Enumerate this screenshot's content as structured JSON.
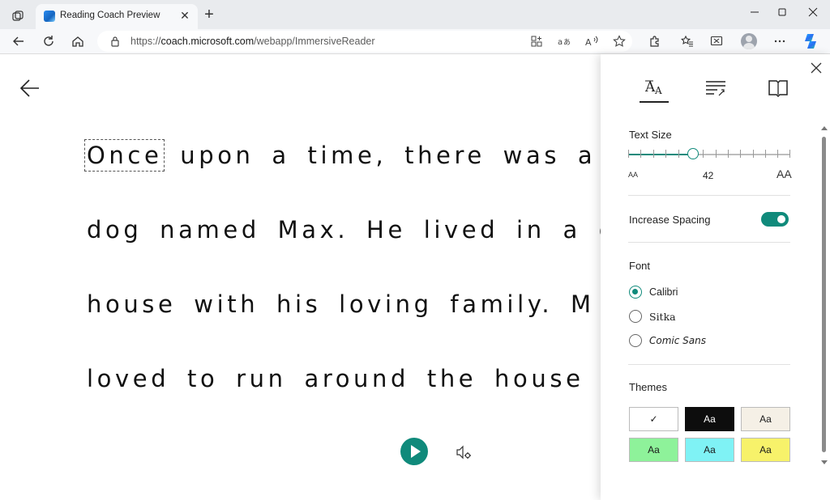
{
  "browser": {
    "tab_title": "Reading Coach Preview",
    "url_prefix": "https://",
    "url_host": "coach.microsoft.com",
    "url_path": "/webapp/ImmersiveReader",
    "new_tab_label": "+",
    "tab_close_label": "✕"
  },
  "reader": {
    "lines": [
      {
        "first": "Once",
        "rest": " upon a time, there was a"
      },
      {
        "first": "",
        "rest": "dog named Max. He lived in a c"
      },
      {
        "first": "",
        "rest": "house with his loving family. M"
      },
      {
        "first": "",
        "rest": "loved to run around the house"
      }
    ]
  },
  "panel": {
    "text_size_label": "Text Size",
    "text_size_value": "42",
    "text_size_fraction": 0.4,
    "small_a": "AA",
    "big_a": "AA",
    "spacing_label": "Increase Spacing",
    "spacing_on": true,
    "font_label": "Font",
    "fonts": [
      {
        "label": "Calibri",
        "selected": true
      },
      {
        "label": "Sitka",
        "selected": false
      },
      {
        "label": "Comic Sans",
        "selected": false
      }
    ],
    "themes_label": "Themes",
    "themes": [
      {
        "label": "✓",
        "bg": "#ffffff",
        "fg": "#333333"
      },
      {
        "label": "Aa",
        "bg": "#0d0d0d",
        "fg": "#ffffff"
      },
      {
        "label": "Aa",
        "bg": "#f5f0e6",
        "fg": "#333333"
      },
      {
        "label": "Aa",
        "bg": "#8ef29a",
        "fg": "#222222"
      },
      {
        "label": "Aa",
        "bg": "#7ff2f5",
        "fg": "#222222"
      },
      {
        "label": "Aa",
        "bg": "#f7f26a",
        "fg": "#222222"
      }
    ]
  },
  "colors": {
    "accent": "#108a7b"
  }
}
